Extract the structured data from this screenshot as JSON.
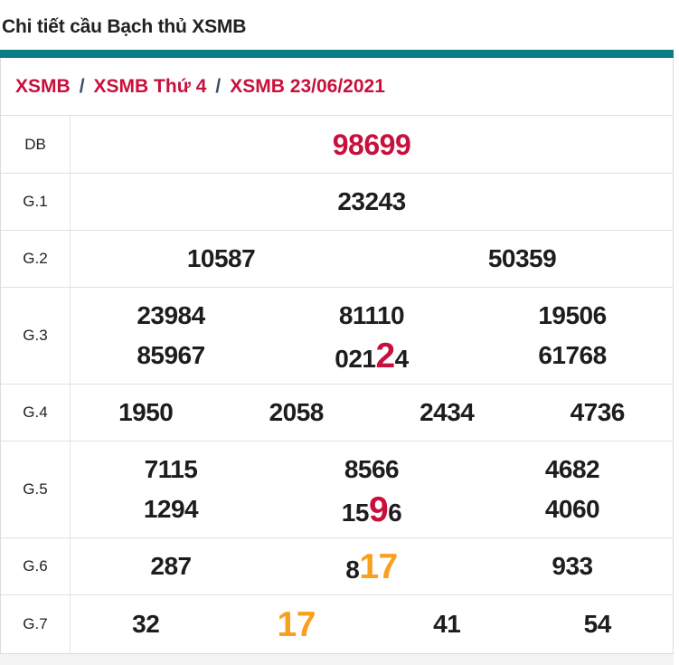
{
  "page": {
    "title": "Chi tiết cầu Bạch thủ XSMB"
  },
  "breadcrumb": {
    "separator": "/",
    "items": [
      {
        "label": "XSMB"
      },
      {
        "label": "XSMB Thứ 4"
      },
      {
        "label": "XSMB 23/06/2021"
      }
    ]
  },
  "colors": {
    "accent_teal": "#0b7d85",
    "highlight_red": "#c9103c",
    "highlight_orange": "#f9a01d",
    "breadcrumb_separator": "#3b4d61",
    "number_text": "#1d1d1d",
    "border": "#e0e0e0"
  },
  "results_table": {
    "rows": [
      {
        "label": "DB",
        "variant": "db",
        "lines": [
          [
            [
              {
                "t": "98699",
                "hl": "red"
              }
            ]
          ]
        ]
      },
      {
        "label": "G.1",
        "lines": [
          [
            [
              {
                "t": "23243"
              }
            ]
          ]
        ]
      },
      {
        "label": "G.2",
        "lines": [
          [
            [
              {
                "t": "10587"
              }
            ],
            [
              {
                "t": "50359"
              }
            ]
          ]
        ]
      },
      {
        "label": "G.3",
        "lines": [
          [
            [
              {
                "t": "23984"
              }
            ],
            [
              {
                "t": "81110"
              }
            ],
            [
              {
                "t": "19506"
              }
            ]
          ],
          [
            [
              {
                "t": "85967"
              }
            ],
            [
              {
                "t": "021"
              },
              {
                "t": "2",
                "hl": "red",
                "big": true
              },
              {
                "t": "4"
              }
            ],
            [
              {
                "t": "61768"
              }
            ]
          ]
        ]
      },
      {
        "label": "G.4",
        "lines": [
          [
            [
              {
                "t": "1950"
              }
            ],
            [
              {
                "t": "2058"
              }
            ],
            [
              {
                "t": "2434"
              }
            ],
            [
              {
                "t": "4736"
              }
            ]
          ]
        ]
      },
      {
        "label": "G.5",
        "lines": [
          [
            [
              {
                "t": "7115"
              }
            ],
            [
              {
                "t": "8566"
              }
            ],
            [
              {
                "t": "4682"
              }
            ]
          ],
          [
            [
              {
                "t": "1294"
              }
            ],
            [
              {
                "t": "15"
              },
              {
                "t": "9",
                "hl": "red",
                "big": true
              },
              {
                "t": "6"
              }
            ],
            [
              {
                "t": "4060"
              }
            ]
          ]
        ]
      },
      {
        "label": "G.6",
        "lines": [
          [
            [
              {
                "t": "287"
              }
            ],
            [
              {
                "t": "8"
              },
              {
                "t": "17",
                "hl": "orange",
                "big": true
              }
            ],
            [
              {
                "t": "933"
              }
            ]
          ]
        ]
      },
      {
        "label": "G.7",
        "lines": [
          [
            [
              {
                "t": "32"
              }
            ],
            [
              {
                "t": "17",
                "hl": "orange",
                "big": true
              }
            ],
            [
              {
                "t": "41"
              }
            ],
            [
              {
                "t": "54"
              }
            ]
          ]
        ]
      }
    ]
  }
}
